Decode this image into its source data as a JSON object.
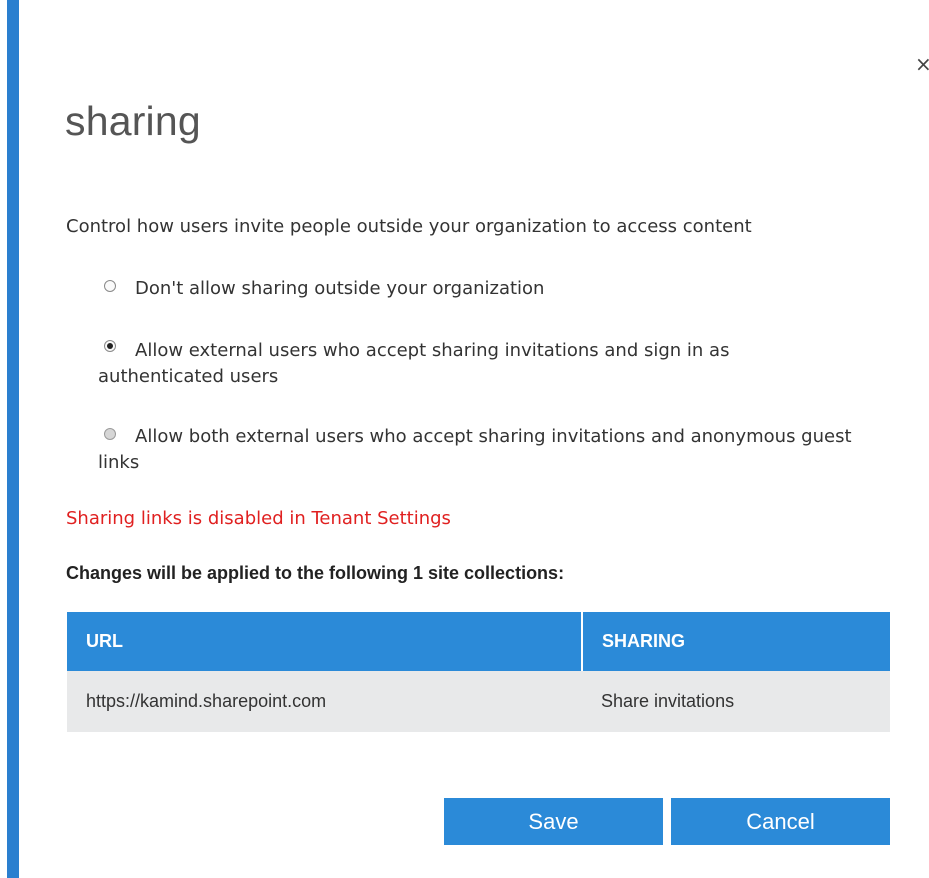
{
  "dialog": {
    "title": "sharing",
    "close_glyph": "×",
    "accent_color": "#2a7fcf"
  },
  "intro": "Control how users invite people outside your organization to access content",
  "options": [
    {
      "label": "Don't allow sharing outside your organization",
      "selected": false,
      "disabled": false
    },
    {
      "label": "Allow external users who accept sharing invitations and sign in as authenticated users",
      "selected": true,
      "disabled": false
    },
    {
      "label": "Allow both external users who accept sharing invitations and anonymous guest links",
      "selected": false,
      "disabled": true
    }
  ],
  "warning": {
    "text": "Sharing links is disabled in Tenant Settings",
    "color": "#e02020"
  },
  "changes_label": "Changes will be applied to the following 1 site collections:",
  "table": {
    "header_color": "#2b8ad8",
    "columns": [
      "URL",
      "SHARING"
    ],
    "rows": [
      [
        "https://kamind.sharepoint.com",
        "Share invitations"
      ]
    ]
  },
  "buttons": {
    "save": "Save",
    "cancel": "Cancel"
  }
}
